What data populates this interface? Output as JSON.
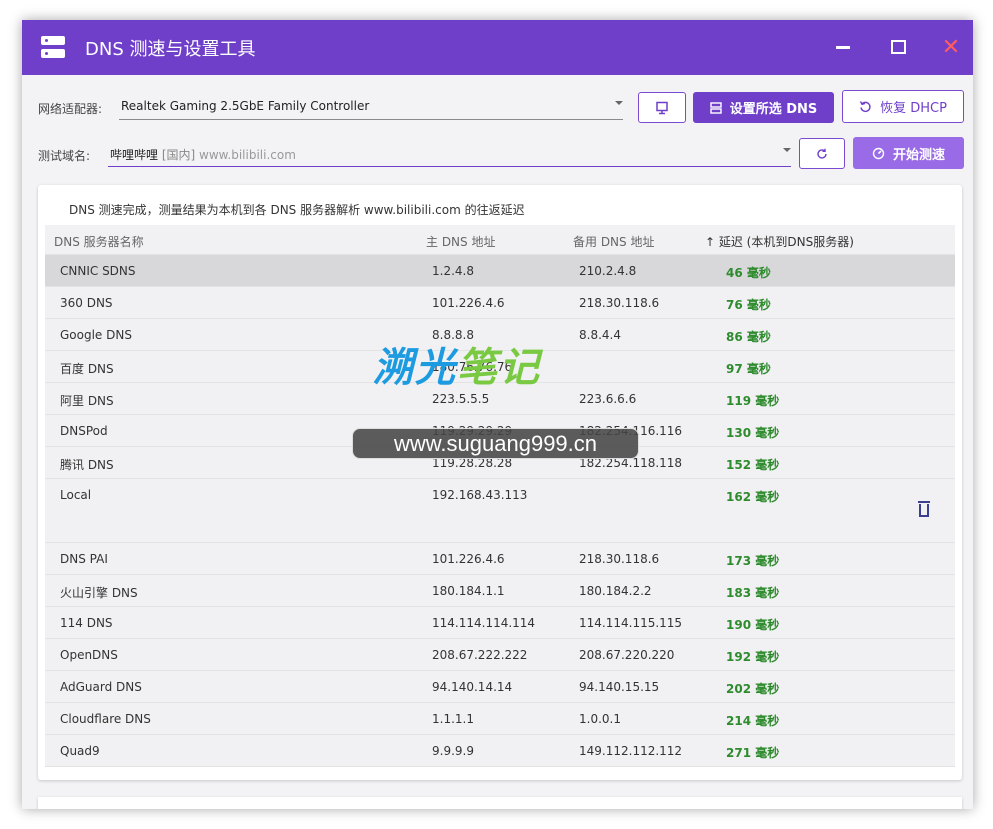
{
  "window": {
    "title": "DNS 测速与设置工具",
    "close_glyph": "✕"
  },
  "adapter": {
    "label": "网络适配器:",
    "value": "Realtek Gaming 2.5GbE Family Controller"
  },
  "domain": {
    "label": "测试域名:",
    "name": "哔哩哔哩",
    "tag": "[国内]",
    "url": "www.bilibili.com"
  },
  "buttons": {
    "set_dns": "设置所选 DNS",
    "restore_dhcp": "恢复 DHCP",
    "start_test": "开始测速"
  },
  "status": "DNS 测速完成，测量结果为本机到各 DNS 服务器解析 www.bilibili.com 的往返延迟",
  "table": {
    "headers": [
      "DNS 服务器名称",
      "主 DNS 地址",
      "备用 DNS 地址",
      "↑ 延迟 (本机到DNS服务器)"
    ],
    "rows": [
      {
        "name": "CNNIC SDNS",
        "primary": "1.2.4.8",
        "secondary": "210.2.4.8",
        "latency": "46 毫秒"
      },
      {
        "name": "360 DNS",
        "primary": "101.226.4.6",
        "secondary": "218.30.118.6",
        "latency": "76 毫秒"
      },
      {
        "name": "Google DNS",
        "primary": "8.8.8.8",
        "secondary": "8.8.4.4",
        "latency": "86 毫秒"
      },
      {
        "name": "百度 DNS",
        "primary": "180.76.76.76",
        "secondary": "",
        "latency": "97 毫秒"
      },
      {
        "name": "阿里 DNS",
        "primary": "223.5.5.5",
        "secondary": "223.6.6.6",
        "latency": "119 毫秒"
      },
      {
        "name": "DNSPod",
        "primary": "119.29.29.29",
        "secondary": "182.254.116.116",
        "latency": "130 毫秒"
      },
      {
        "name": "腾讯 DNS",
        "primary": "119.28.28.28",
        "secondary": "182.254.118.118",
        "latency": "152 毫秒"
      },
      {
        "name": "Local",
        "primary": "192.168.43.113",
        "secondary": "",
        "latency": "162 毫秒"
      },
      {
        "name": "DNS PAI",
        "primary": "101.226.4.6",
        "secondary": "218.30.118.6",
        "latency": "173 毫秒"
      },
      {
        "name": "火山引擎 DNS",
        "primary": "180.184.1.1",
        "secondary": "180.184.2.2",
        "latency": "183 毫秒"
      },
      {
        "name": "114 DNS",
        "primary": "114.114.114.114",
        "secondary": "114.114.115.115",
        "latency": "190 毫秒"
      },
      {
        "name": "OpenDNS",
        "primary": "208.67.222.222",
        "secondary": "208.67.220.220",
        "latency": "192 毫秒"
      },
      {
        "name": "AdGuard DNS",
        "primary": "94.140.14.14",
        "secondary": "94.140.15.15",
        "latency": "202 毫秒"
      },
      {
        "name": "Cloudflare DNS",
        "primary": "1.1.1.1",
        "secondary": "1.0.0.1",
        "latency": "214 毫秒"
      },
      {
        "name": "Quad9",
        "primary": "9.9.9.9",
        "secondary": "149.112.112.112",
        "latency": "271 毫秒"
      }
    ]
  },
  "watermark": {
    "logo_part1": "溯光",
    "logo_part2": "笔记",
    "url": "www.suguang999.cn"
  },
  "colors": {
    "accent": "#6f3fca",
    "latency_text": "#2e8b2e",
    "close_icon": "#ff5c5c"
  }
}
